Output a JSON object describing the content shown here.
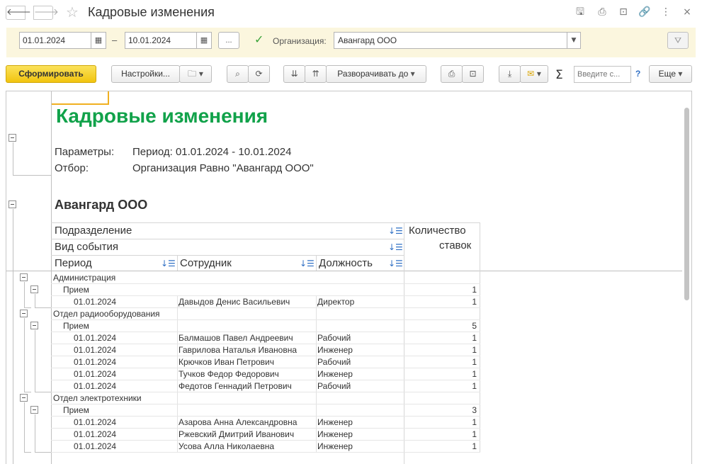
{
  "window": {
    "title": "Кадровые изменения",
    "icons": [
      "save-icon",
      "print-icon",
      "preview-icon",
      "link-icon",
      "more-vert-icon",
      "close-icon"
    ]
  },
  "filters": {
    "date_from": "01.01.2024",
    "date_to": "10.01.2024",
    "dash": "–",
    "dots_label": "...",
    "org_label": "Организация:",
    "org_value": "Авангард ООО"
  },
  "toolbar": {
    "generate": "Сформировать",
    "settings": "Настройки...",
    "expand_to": "Разворачивать до",
    "search_placeholder": "Введите с...",
    "help": "?",
    "more": "Еще"
  },
  "report": {
    "title": "Кадровые изменения",
    "params_label": "Параметры:",
    "params_value": "Период: 01.01.2024 - 10.01.2024",
    "filter_label": "Отбор:",
    "filter_value": "Организация Равно \"Авангард ООО\"",
    "org": "Авангард ООО",
    "headers": {
      "department": "Подразделение",
      "event_type": "Вид события",
      "period": "Период",
      "employee": "Сотрудник",
      "position": "Должность",
      "qty_line1": "Количество",
      "qty_line2": "ставок"
    },
    "groups": [
      {
        "department": "Администрация",
        "event": "Прием",
        "event_qty": "1",
        "rows": [
          {
            "date": "01.01.2024",
            "employee": "Давыдов Денис Васильевич",
            "position": "Директор",
            "qty": "1"
          }
        ]
      },
      {
        "department": "Отдел радиооборудования",
        "event": "Прием",
        "event_qty": "5",
        "rows": [
          {
            "date": "01.01.2024",
            "employee": "Балмашов Павел Андреевич",
            "position": "Рабочий",
            "qty": "1"
          },
          {
            "date": "01.01.2024",
            "employee": "Гаврилова Наталья Ивановна",
            "position": "Инженер",
            "qty": "1"
          },
          {
            "date": "01.01.2024",
            "employee": "Крючков Иван Петрович",
            "position": "Рабочий",
            "qty": "1"
          },
          {
            "date": "01.01.2024",
            "employee": "Тучков Федор Федорович",
            "position": "Инженер",
            "qty": "1"
          },
          {
            "date": "01.01.2024",
            "employee": "Федотов Геннадий Петрович",
            "position": "Рабочий",
            "qty": "1"
          }
        ]
      },
      {
        "department": "Отдел электротехники",
        "event": "Прием",
        "event_qty": "3",
        "rows": [
          {
            "date": "01.01.2024",
            "employee": "Азарова Анна Александровна",
            "position": "Инженер",
            "qty": "1"
          },
          {
            "date": "01.01.2024",
            "employee": "Ржевский Дмитрий Иванович",
            "position": "Инженер",
            "qty": "1"
          },
          {
            "date": "01.01.2024",
            "employee": "Усова Алла Николаевна",
            "position": "Инженер",
            "qty": "1"
          }
        ]
      }
    ]
  }
}
